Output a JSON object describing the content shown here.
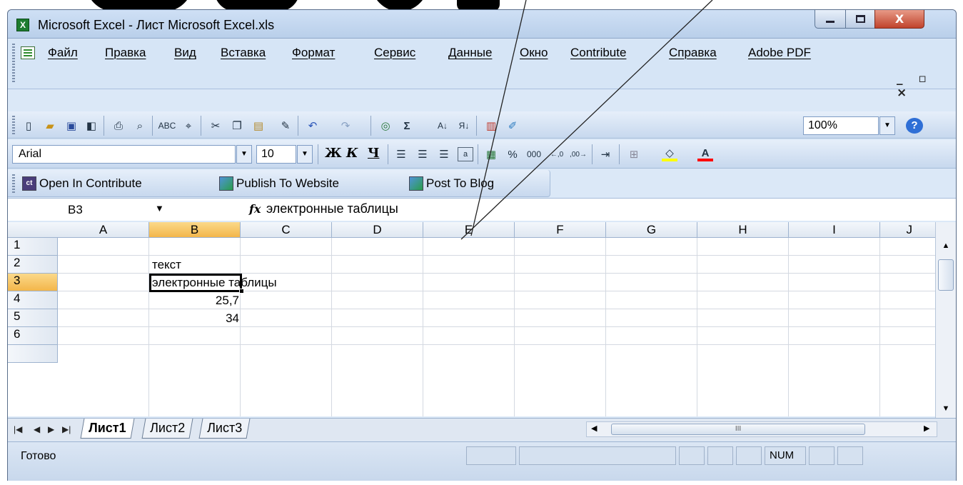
{
  "window": {
    "title": "Microsoft Excel - Лист Microsoft Excel.xls",
    "app_icon": "excel-icon",
    "controls": {
      "minimize": "—",
      "maximize": "□",
      "close": "X"
    }
  },
  "menu": {
    "items": [
      "Файл",
      "Правка",
      "Вид",
      "Вставка",
      "Формат",
      "Сервис",
      "Данные",
      "Окно",
      "Contribute",
      "Справка",
      "Adobe PDF"
    ],
    "doc_controls": "_ ▫ ×"
  },
  "toolbar_standard": {
    "icons": [
      "new-icon",
      "open-icon",
      "save-icon",
      "permission-icon",
      "print-icon",
      "print-preview-icon",
      "spelling-icon",
      "research-icon",
      "cut-icon",
      "copy-icon",
      "paste-icon",
      "format-painter-icon",
      "undo-icon",
      "redo-icon",
      "hyperlink-icon",
      "autosum-icon",
      "sort-ascending-icon",
      "sort-descending-icon",
      "chart-wizard-icon",
      "drawing-icon"
    ],
    "zoom": "100%",
    "help_icon": "help-icon"
  },
  "toolbar_format": {
    "font": "Arial",
    "size": "10",
    "bold": "Ж",
    "italic": "К",
    "underline": "Ч",
    "percent": "%",
    "thousands": "000",
    "icons": [
      "align-left-icon",
      "align-center-icon",
      "align-right-icon",
      "merge-center-icon",
      "currency-icon",
      "increase-decimal-icon",
      "decrease-decimal-icon",
      "indent-icon",
      "borders-icon",
      "fill-color-icon",
      "font-color-icon"
    ],
    "colors": {
      "fill": "#ffff00",
      "font": "#ff0000"
    }
  },
  "toolbar_contribute": {
    "open": "Open In Contribute",
    "publish": "Publish To Website",
    "blog": "Post To Blog"
  },
  "formula_bar": {
    "name_box": "B3",
    "fx": "fx",
    "formula": "электронные таблицы"
  },
  "sheet": {
    "columns": [
      "A",
      "B",
      "C",
      "D",
      "E",
      "F",
      "G",
      "H",
      "I",
      "J"
    ],
    "rows": [
      "1",
      "2",
      "3",
      "4",
      "5",
      "6"
    ],
    "selected_column": "B",
    "selected_row": "3",
    "cells": {
      "B2": "текст",
      "B3": "электронные таблицы",
      "B4": "25,7",
      "B5": "34"
    }
  },
  "tabs": {
    "sheets": [
      "Лист1",
      "Лист2",
      "Лист3"
    ],
    "active": "Лист1",
    "scroll_thumb": "III"
  },
  "status": {
    "text": "Готово",
    "num": "NUM"
  }
}
